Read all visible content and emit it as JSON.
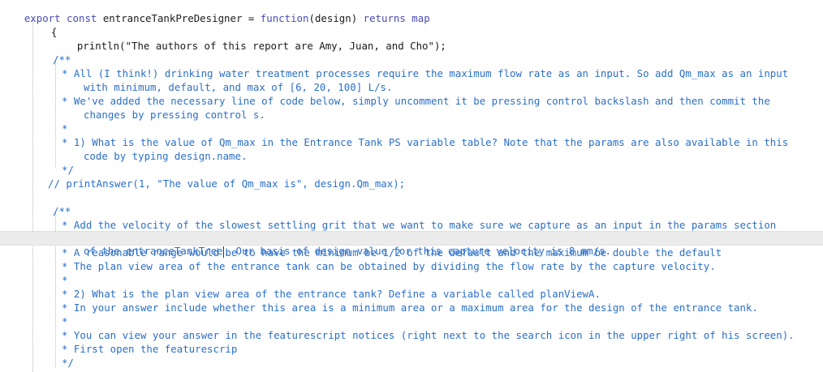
{
  "code": {
    "l1_kw1": "export const ",
    "l1_name": "entranceTankPreDesigner",
    "l1_eq": " = ",
    "l1_kw2": "function",
    "l1_args": "(design) ",
    "l1_kw3": "returns map",
    "l2": "{",
    "l3": "println(\"The authors of this report are Amy, Juan, and Cho\");",
    "c1_open": "/**",
    "c1_l1": "* All (I think!) drinking water treatment processes require the maximum flow rate as an input. So add Qm_max as an input",
    "c1_l2": "with minimum, default, and max of [6, 20, 100] L/s.",
    "c1_l3": "* We've added the necessary line of code below, simply uncomment it be pressing control backslash and then commit the",
    "c1_l4": "changes by pressing control s.",
    "c1_l5": "*",
    "c1_l6": "* 1) What is the value of Qm_max in the Entrance Tank PS variable table? Note that the params are also available in this",
    "c1_l7": "code by typing design.name.",
    "c1_close": "*/",
    "print_answer": "// printAnswer(1, \"The value of Qm_max is\", design.Qm_max);",
    "c2_open": "/**",
    "c2_l1": "* Add the velocity of the slowest settling grit that we want to make sure we capture as an input in the params section",
    "c2_l2a": "of the entranceTankTree",
    "c2_l2b": ". Our basis of design value for this capture velocity is 8 mm/s.",
    "c2_l3": "* A reasonable range would be to have the minimum be 1/2 of the default and the maximum be double the default",
    "c2_l4": "* The plan view area of the entrance tank can be obtained by dividing the flow rate by the capture velocity.",
    "c2_l5": "*",
    "c2_l6": "* 2) What is the plan view area of the entrance tank? Define a variable called planViewA.",
    "c2_l7": "* In your answer include whether this area is a minimum area or a maximum area for the design of the entrance tank.",
    "c2_l8": "*",
    "c2_l9": "* You can view your answer in the featurescript notices (right next to the search icon in the upper right of his screen).",
    "c2_l10": "* First open the featurescrip",
    "c2_close": "*/"
  },
  "colors": {
    "keyword": "#4a4ab8",
    "comment": "#2a6fc9",
    "text": "#1a1a1a",
    "current_line": "#ececec"
  }
}
